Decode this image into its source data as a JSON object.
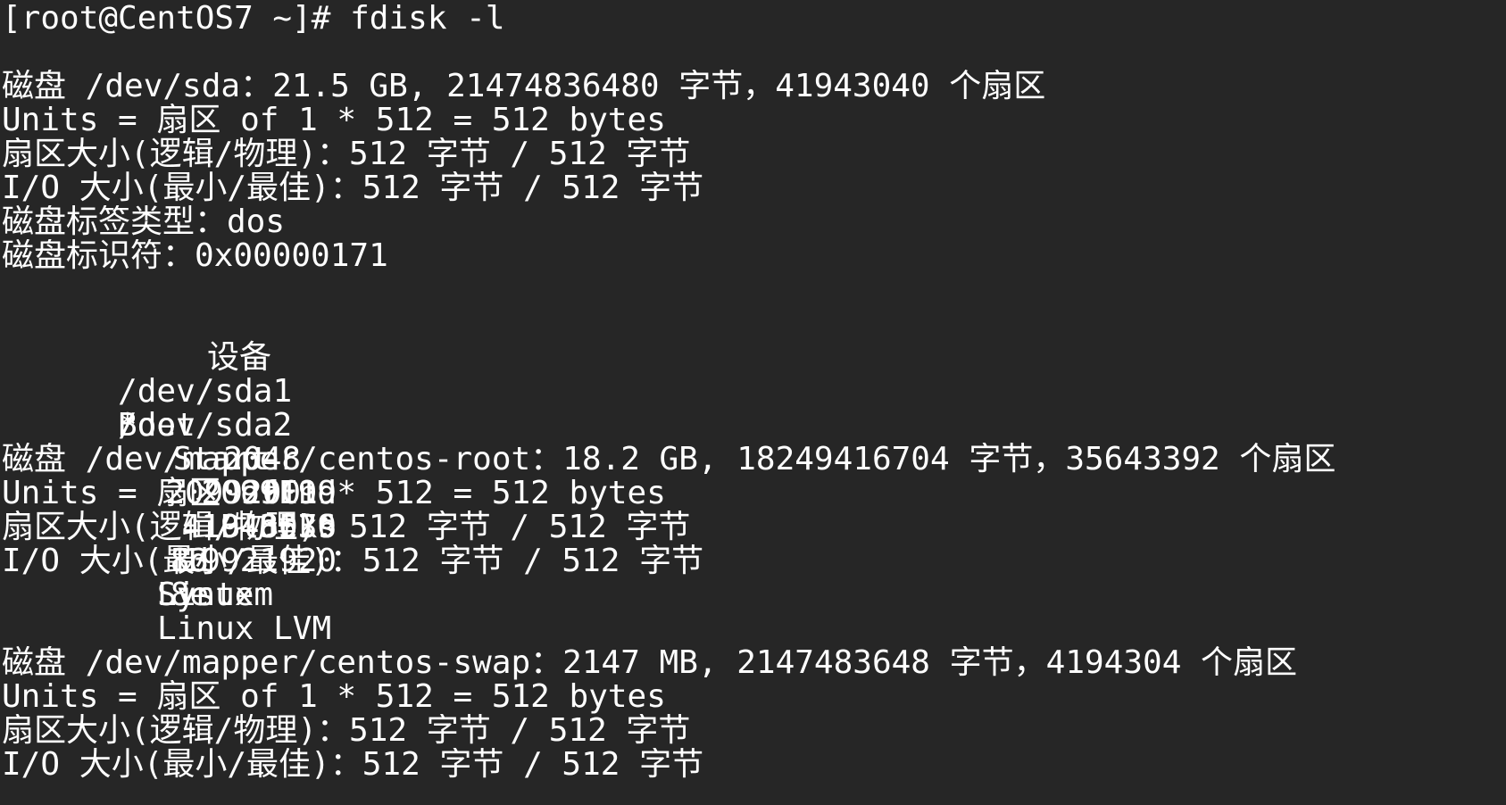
{
  "terminal": {
    "prompt_line": "[root@CentOS7 ~]# fdisk -l",
    "disks": [
      {
        "summary": "磁盘 /dev/sda：21.5 GB, 21474836480 字节，41943040 个扇区",
        "units": "Units = 扇区 of 1 * 512 = 512 bytes",
        "sector_size": "扇区大小(逻辑/物理)：512 字节 / 512 字节",
        "io_size": "I/O 大小(最小/最佳)：512 字节 / 512 字节",
        "label_type": "磁盘标签类型：dos",
        "identifier": "磁盘标识符：0x00000171"
      },
      {
        "summary": "磁盘 /dev/mapper/centos-root：18.2 GB, 18249416704 字节，35643392 个扇区",
        "units": "Units = 扇区 of 1 * 512 = 512 bytes",
        "sector_size": "扇区大小(逻辑/物理)：512 字节 / 512 字节",
        "io_size": "I/O 大小(最小/最佳)：512 字节 / 512 字节"
      },
      {
        "summary": "磁盘 /dev/mapper/centos-swap：2147 MB, 2147483648 字节，4194304 个扇区",
        "units": "Units = 扇区 of 1 * 512 = 512 bytes",
        "sector_size": "扇区大小(逻辑/物理)：512 字节 / 512 字节",
        "io_size": "I/O 大小(最小/最佳)：512 字节 / 512 字节"
      }
    ],
    "partition_table": {
      "headers": [
        "设备",
        "Boot",
        "Start",
        "End",
        "Blocks",
        "Id",
        "System"
      ],
      "rows": [
        [
          "/dev/sda1",
          "*",
          "2048",
          "2099199",
          "1048576",
          "83",
          "Linux"
        ],
        [
          "/dev/sda2",
          "",
          "2099200",
          "41943039",
          "19921920",
          "8e",
          "Linux LVM"
        ]
      ]
    }
  }
}
